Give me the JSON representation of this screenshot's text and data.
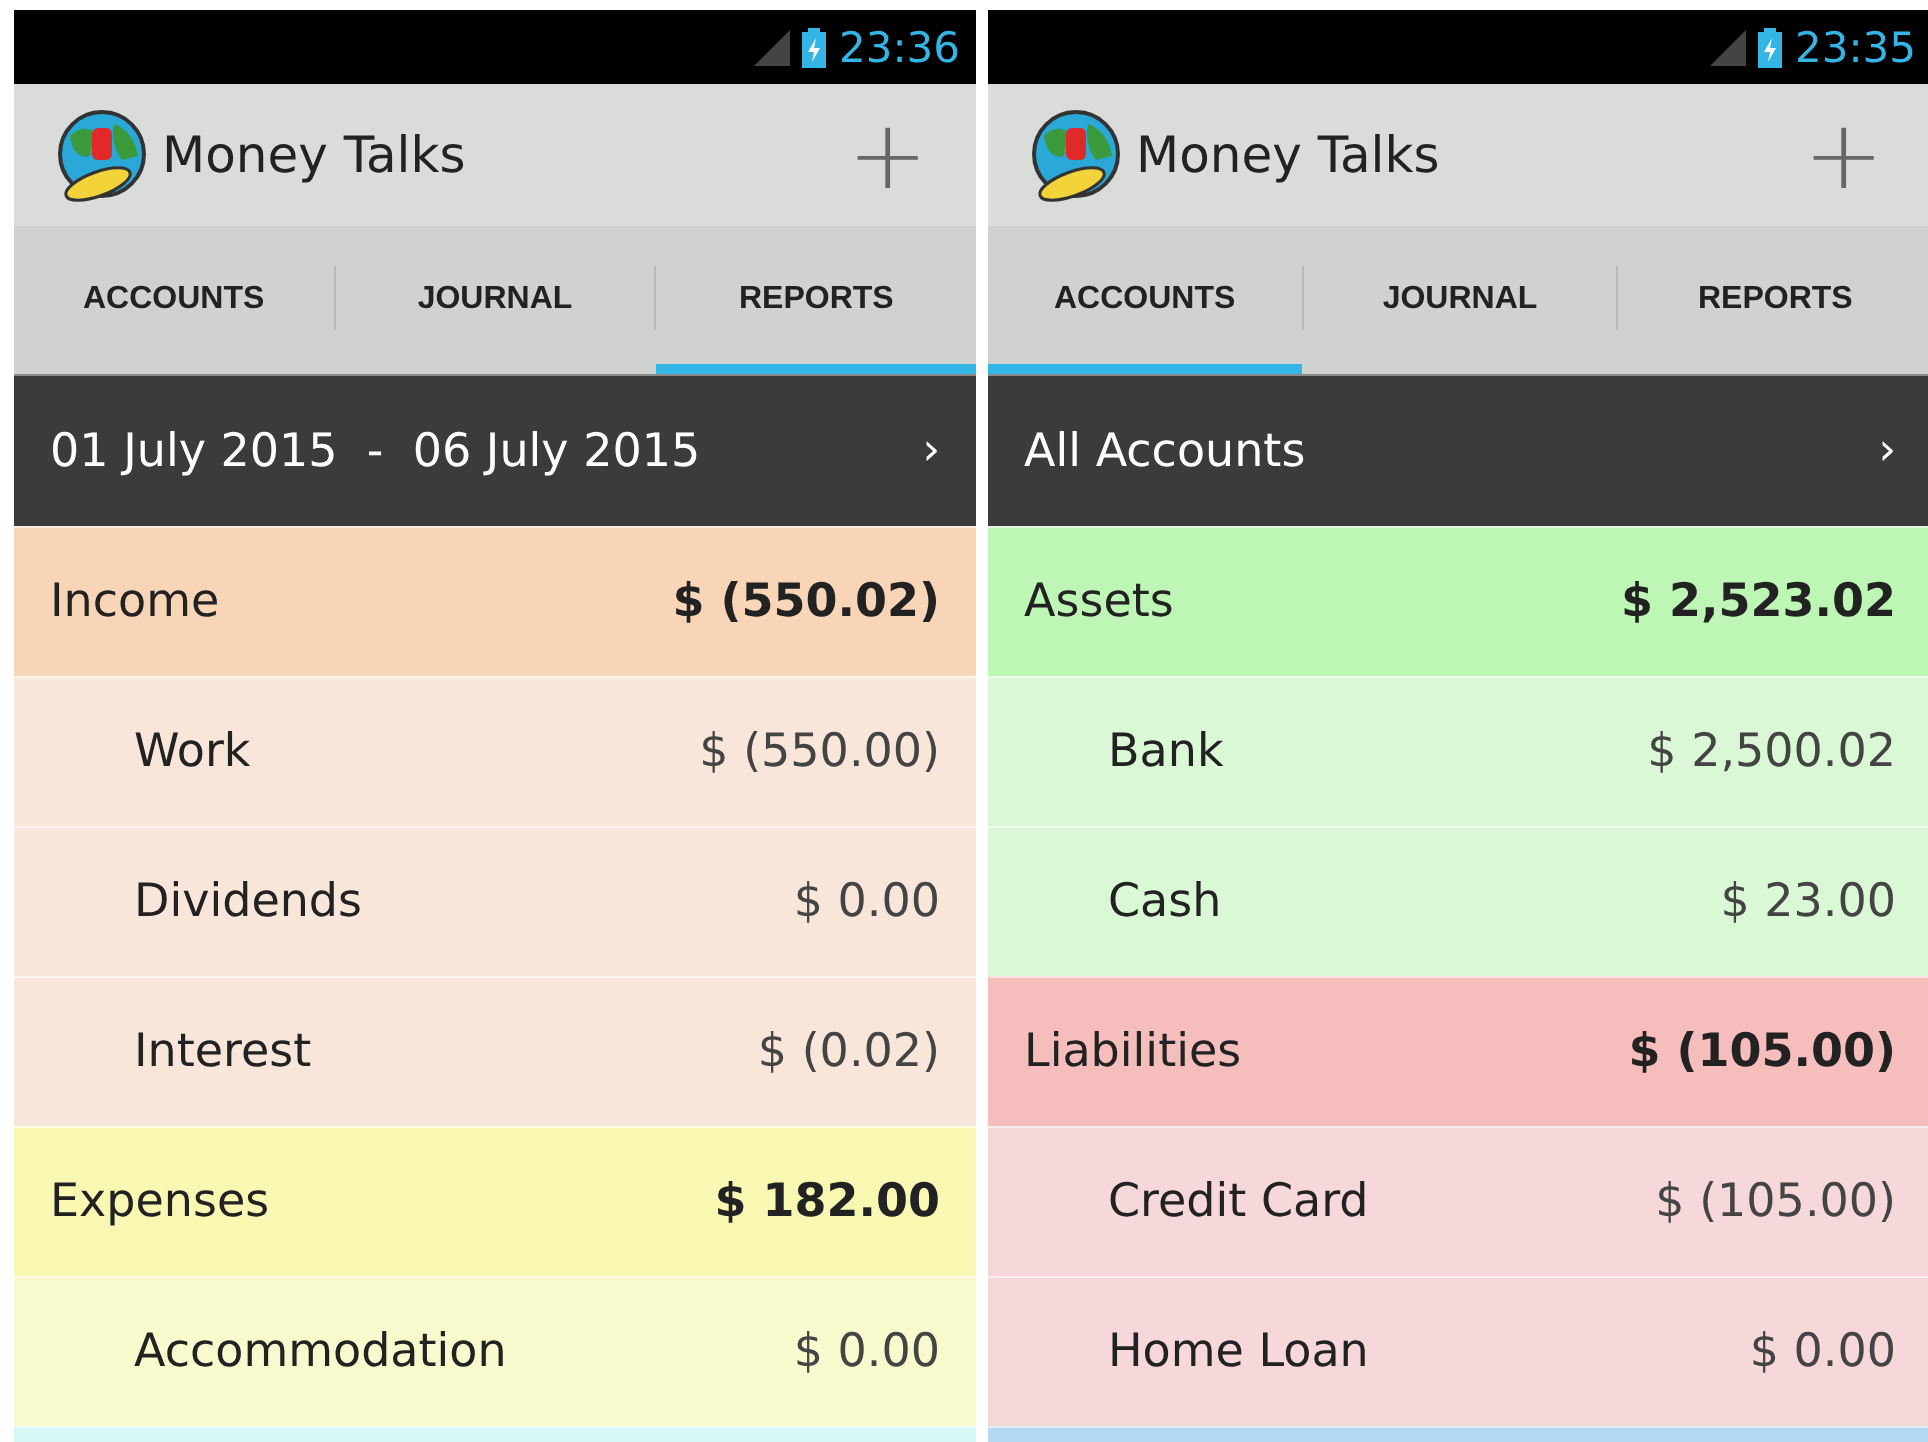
{
  "screens": [
    {
      "status_time": "23:36",
      "app_title": "Money Talks",
      "add_button": "+",
      "tabs": [
        {
          "label": "ACCOUNTS",
          "selected": false
        },
        {
          "label": "JOURNAL",
          "selected": false
        },
        {
          "label": "REPORTS",
          "selected": true
        }
      ],
      "header": {
        "label": "01 July 2015  -  06 July 2015",
        "chevron": "›"
      },
      "groups": [
        {
          "name": "Income",
          "amount": "$ (550.02)",
          "color": "#f9d5b7",
          "children": [
            {
              "name": "Work",
              "amount": "$ (550.00)",
              "color": "#f9e6da"
            },
            {
              "name": "Dividends",
              "amount": "$ 0.00",
              "color": "#f9e6da"
            },
            {
              "name": "Interest",
              "amount": "$ (0.02)",
              "color": "#f9e6da"
            }
          ]
        },
        {
          "name": "Expenses",
          "amount": "$ 182.00",
          "color": "#f8f8b2",
          "children": [
            {
              "name": "Accommodation",
              "amount": "$ 0.00",
              "color": "#f8f9cd"
            }
          ]
        },
        {
          "color": "#d6f8f7"
        }
      ]
    },
    {
      "status_time": "23:35",
      "app_title": "Money Talks",
      "add_button": "+",
      "tabs": [
        {
          "label": "ACCOUNTS",
          "selected": true
        },
        {
          "label": "JOURNAL",
          "selected": false
        },
        {
          "label": "REPORTS",
          "selected": false
        }
      ],
      "header": {
        "label": "All Accounts",
        "chevron": "›"
      },
      "groups": [
        {
          "name": "Assets",
          "amount": "$ 2,523.02",
          "color": "#bdf6b5",
          "children": [
            {
              "name": "Bank",
              "amount": "$ 2,500.02",
              "color": "#daf8d5"
            },
            {
              "name": "Cash",
              "amount": "$ 23.00",
              "color": "#daf8d5"
            }
          ]
        },
        {
          "name": "Liabilities",
          "amount": "$ (105.00)",
          "color": "#f5bdbc",
          "children": [
            {
              "name": "Credit Card",
              "amount": "$ (105.00)",
              "color": "#f6d7da"
            },
            {
              "name": "Home Loan",
              "amount": "$ 0.00",
              "color": "#f6d7da"
            }
          ]
        },
        {
          "color": "#b4d9f2"
        }
      ]
    }
  ]
}
